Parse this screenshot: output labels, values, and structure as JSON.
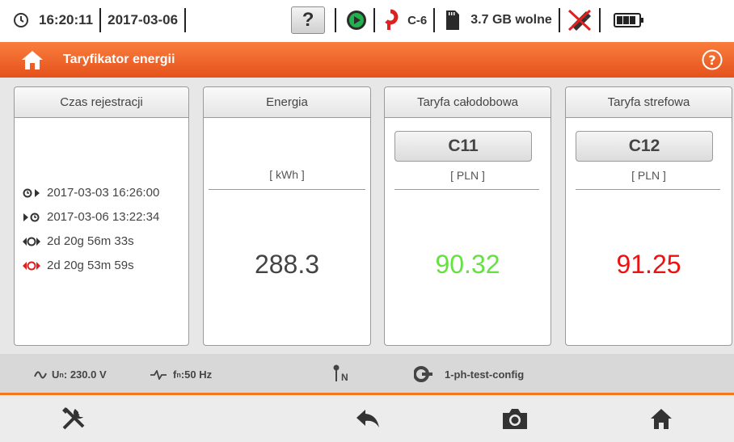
{
  "status": {
    "time": "16:20:11",
    "date": "2017-03-06",
    "help_label": "?",
    "clamp_label": "C-6",
    "storage_label": "3.7 GB wolne"
  },
  "header": {
    "title": "Taryfikator energii"
  },
  "panels": {
    "recording": {
      "title": "Czas rejestracji",
      "start": "2017-03-03 16:26:00",
      "end": "2017-03-06 13:22:34",
      "duration": "2d 20g 56m 33s",
      "duration_red": "2d 20g 53m 59s"
    },
    "energy": {
      "title": "Energia",
      "unit": "[ kWh ]",
      "value": "288.3"
    },
    "tariff_24h": {
      "title": "Taryfa całodobowa",
      "button": "C11",
      "unit": "[ PLN ]",
      "value": "90.32"
    },
    "tariff_zone": {
      "title": "Taryfa strefowa",
      "button": "C12",
      "unit": "[ PLN ]",
      "value": "91.25"
    }
  },
  "info": {
    "voltage_prefix": "U",
    "voltage_sub": "n",
    "voltage_value": ": 230.0 V",
    "freq_prefix": "f",
    "freq_sub": "n",
    "freq_value": ":50 Hz",
    "n_label": "N",
    "config": "1-ph-test-config"
  },
  "colors": {
    "accent": "#f2791f",
    "green_value": "#64e23f",
    "red_value": "#ee1111",
    "red_icon": "#e02020"
  }
}
